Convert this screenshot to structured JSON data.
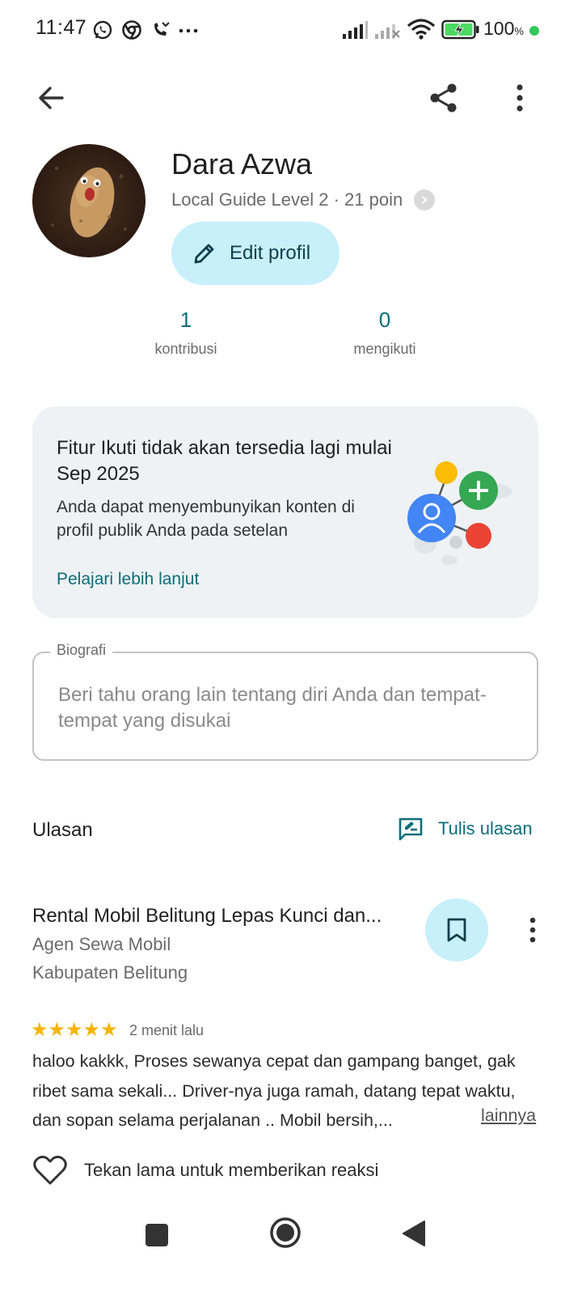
{
  "status_bar": {
    "time": "11:47",
    "battery": "100",
    "battery_unit": "%",
    "icons": [
      "whatsapp-icon",
      "chrome-icon",
      "missed-call-icon",
      "more-notifications-icon",
      "signal-icon",
      "signal-no-service-icon",
      "wifi-icon",
      "battery-charging-icon"
    ]
  },
  "app_bar": {
    "back_icon": "arrow-back-icon",
    "share_icon": "share-icon",
    "menu_icon": "more-vert-icon"
  },
  "profile": {
    "name": "Dara Azwa",
    "level": "Local Guide Level 2 · 21 poin",
    "edit_label": "Edit profil",
    "stats": [
      {
        "value": "1",
        "label": "kontribusi"
      },
      {
        "value": "0",
        "label": "mengikuti"
      }
    ]
  },
  "notice_card": {
    "title": "Fitur Ikuti tidak akan tersedia lagi mulai Sep 2025",
    "body": "Anda dapat menyembunyikan konten di profil publik Anda pada setelan",
    "link": "Pelajari lebih lanjut"
  },
  "bio": {
    "label": "Biografi",
    "placeholder": "Beri tahu orang lain tentang diri Anda dan tempat-tempat yang disukai"
  },
  "reviews": {
    "title": "Ulasan",
    "write_label": "Tulis ulasan",
    "items": [
      {
        "place": "Rental Mobil Belitung Lepas Kunci dan...",
        "category": "Agen Sewa Mobil",
        "location": "Kabupaten Belitung",
        "rating": 5,
        "stars": "★★★★★",
        "time": "2 menit lalu",
        "text": "haloo kakkk, Proses sewanya cepat dan gampang banget, gak ribet sama sekali... Driver-nya juga ramah, datang tepat waktu, dan sopan selama perjalanan .. Mobil bersih,...",
        "more": "lainnya",
        "react_label": "Tekan lama untuk memberikan reaksi"
      }
    ]
  },
  "colors": {
    "accent": "#0b6e7a",
    "chip_bg": "#c7f0fa",
    "card_bg": "#eef2f4",
    "star": "#f6b400"
  }
}
